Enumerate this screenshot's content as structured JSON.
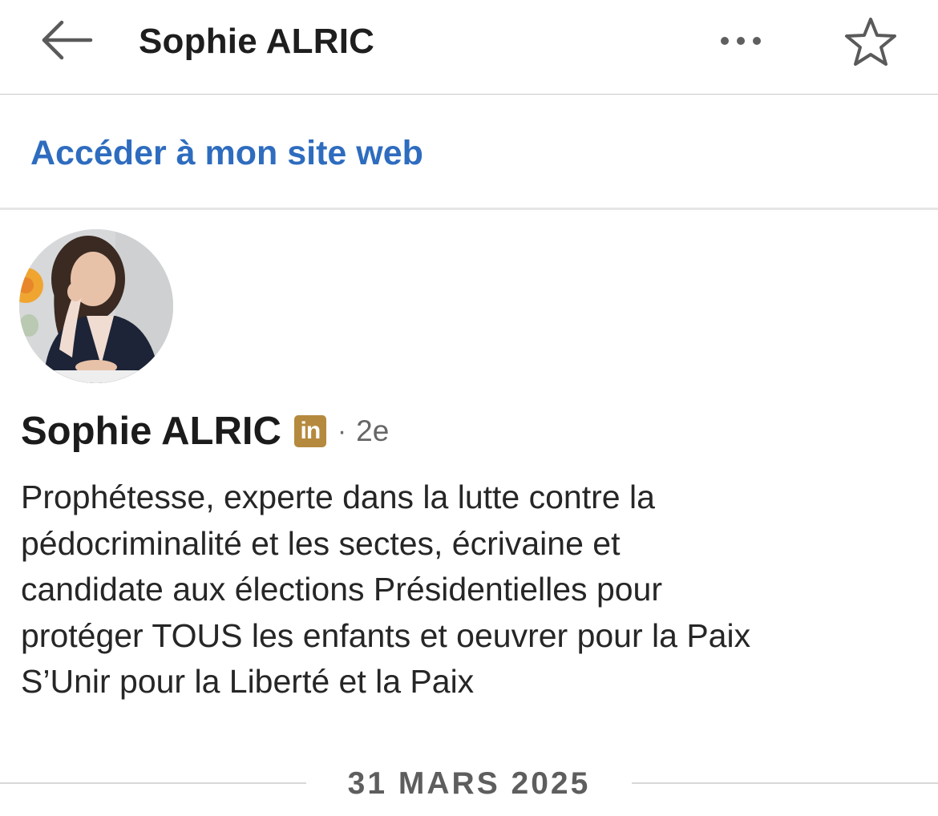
{
  "header": {
    "title": "Sophie ALRIC",
    "back_icon": "arrow-left-icon",
    "more_icon": "more-horizontal-icon",
    "favorite_icon": "star-outline-icon"
  },
  "website": {
    "link_label": "Accéder à mon site web",
    "link_color": "#2e6cbf"
  },
  "profile": {
    "name": "Sophie ALRIC",
    "badge_text": "in",
    "badge_color": "#b58a3e",
    "separator": "·",
    "degree": "2e",
    "headline_lines": [
      "Prophétesse, experte dans la lutte contre la",
      "pédocriminalité et les sectes, écrivaine et",
      "candidate aux élections Présidentielles pour",
      "protéger TOUS les enfants et oeuvrer pour la Paix",
      "S’Unir pour la Liberté et la Paix"
    ]
  },
  "date_separator": {
    "label": "31 MARS 2025"
  }
}
